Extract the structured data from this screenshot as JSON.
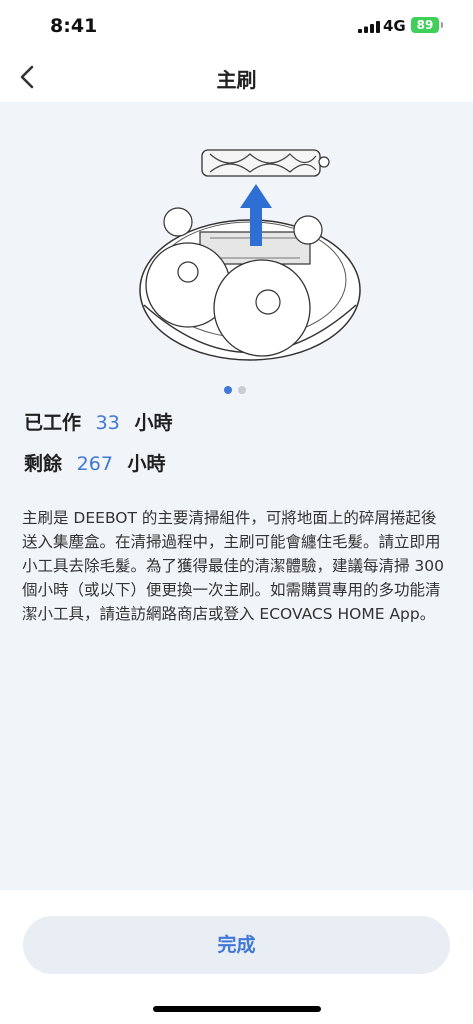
{
  "status_bar": {
    "time": "8:41",
    "network": "4G",
    "battery": "89"
  },
  "nav": {
    "title": "主刷",
    "back_icon": "chevron-left-icon"
  },
  "illustration": {
    "icon": "robot-main-brush-illustration",
    "arrow_color": "#2f6fd4"
  },
  "carousel": {
    "total": 2,
    "active": 1
  },
  "stats": {
    "worked_label": "已工作",
    "worked_value": "33",
    "worked_unit": "小時",
    "remaining_label": "剩餘",
    "remaining_value": "267",
    "remaining_unit": "小時"
  },
  "description": "主刷是 DEEBOT 的主要清掃組件，可將地面上的碎屑捲起後送入集塵盒。在清掃過程中，主刷可能會纏住毛髮。請立即用小工具去除毛髮。為了獲得最佳的清潔體驗，建議每清掃 300 個小時（或以下）便更換一次主刷。如需購買專用的多功能清潔小工具，請造訪網路商店或登入 ECOVACS HOME App。",
  "footer": {
    "done_label": "完成"
  },
  "colors": {
    "accent": "#3f78d8",
    "background": "#f1f4f9"
  }
}
